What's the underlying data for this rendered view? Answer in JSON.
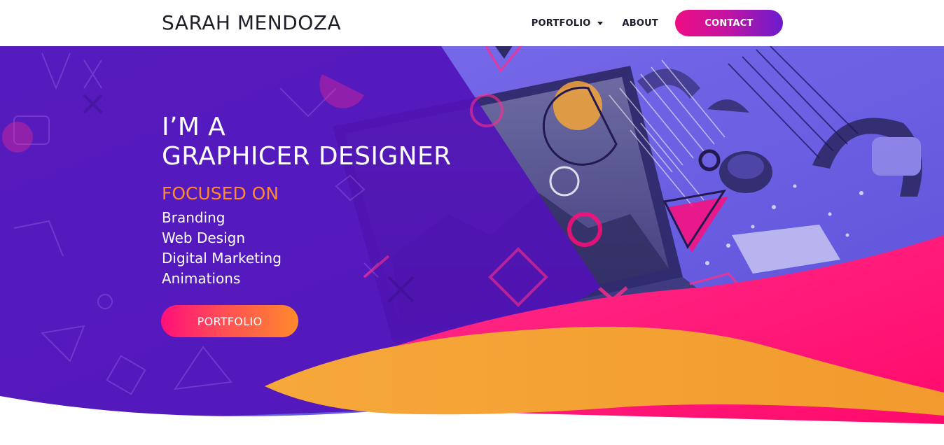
{
  "header": {
    "brand": "SARAH MENDOZA",
    "nav": {
      "portfolio_label": "PORTFOLIO",
      "about_label": "ABOUT",
      "contact_label": "CONTACT"
    }
  },
  "hero": {
    "title_line1": "I’M A",
    "title_line2": "GRAPHICER DESIGNER",
    "focused_label": "FOCUSED ON",
    "skills": [
      "Branding",
      "Web Design",
      "Digital Marketing",
      "Animations"
    ],
    "cta_label": "PORTFOLIO"
  },
  "colors": {
    "hero_purple": "#5212b8",
    "photo_overlay": "#6a5ce6",
    "accent_orange": "#ff8a2a",
    "accent_pink": "#ff0d7a",
    "wave_orange": "#f5a031"
  },
  "icons": {
    "nav_dropdown": "chevron-down-icon"
  }
}
